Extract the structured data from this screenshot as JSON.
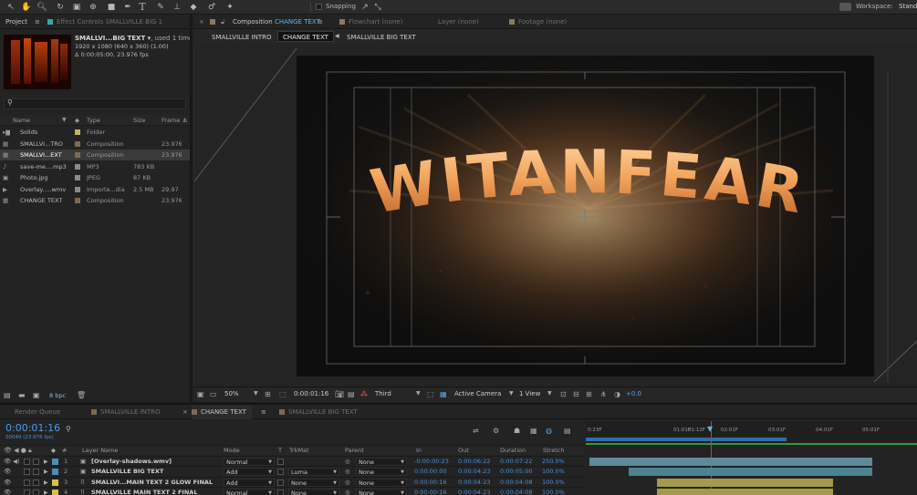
{
  "toolbar": {
    "tools": [
      "arrow-tool-icon",
      "hand-tool-icon",
      "zoom-tool-icon",
      "rotate-tool-icon",
      "camera-tool-icon",
      "pan-behind-icon",
      "rectangle-tool-icon",
      "pen-tool-icon",
      "type-tool-icon",
      "brush-tool-icon",
      "clone-stamp-icon",
      "eraser-tool-icon",
      "roto-brush-icon",
      "puppet-tool-icon"
    ],
    "snapping_label": "Snapping",
    "workspace_label": "Workspace:",
    "workspace_value": "Stand"
  },
  "project_panel": {
    "tab_label": "Project",
    "effect_controls_tab": "Effect Controls SMALLVILLE BIG 1",
    "item_name": "SMALLVI...BIG TEXT ▾",
    "item_used": ", used 1 time",
    "item_res": "1920 x 1080  (640 x 360) (1.00)",
    "item_dur": "Δ 0:00:05:00, 23.976 fps",
    "search_placeholder": "",
    "columns": [
      "Name",
      "Type",
      "Size",
      "Frame ..."
    ],
    "items": [
      {
        "name": "Solids",
        "type": "Folder",
        "size": "",
        "frame": "",
        "color": "#c8b260",
        "icon": "folder-icon"
      },
      {
        "name": "SMALLVI...TRO",
        "type": "Composition",
        "size": "",
        "frame": "23.976",
        "color": "#7f6a50",
        "icon": "composition-icon"
      },
      {
        "name": "SMALLVI...EXT",
        "type": "Composition",
        "size": "",
        "frame": "23.976",
        "color": "#7f6a50",
        "icon": "composition-icon"
      },
      {
        "name": "save-me....mp3",
        "type": "MP3",
        "size": "783 KB",
        "frame": "",
        "color": "#8a8a8a",
        "icon": "audio-file-icon"
      },
      {
        "name": "Photo.jpg",
        "type": "JPEG",
        "size": "87 KB",
        "frame": "",
        "color": "#8a8a8a",
        "icon": "image-file-icon"
      },
      {
        "name": "Overlay.....wmv",
        "type": "Importe...dia",
        "size": "2.5 MB",
        "frame": "29.97",
        "color": "#8a8a8a",
        "icon": "video-file-icon"
      },
      {
        "name": "CHANGE TEXT",
        "type": "Composition",
        "size": "",
        "frame": "23.976",
        "color": "#7f6a50",
        "icon": "composition-icon"
      }
    ],
    "bpc_label": "8 bpc"
  },
  "viewer": {
    "tabs": [
      {
        "label": "Composition",
        "accent": "CHANGE TEXT"
      },
      {
        "label": "Flowchart (none)"
      },
      {
        "label": "Layer (none)"
      },
      {
        "label": "Footage (none)"
      }
    ],
    "breadcrumbs": [
      "SMALLVILLE INTRO",
      "CHANGE TEXT",
      "SMALLVILLE BIG TEXT"
    ],
    "title_text": "WITANFEAR",
    "zoom": "50%",
    "timecode": "0:00:01:16",
    "resolution": "Third",
    "camera": "Active Camera",
    "view_count": "1 View",
    "exposure": "+0.0"
  },
  "timeline": {
    "tabs": [
      "Render Queue",
      "SMALLVILLE INTRO",
      "CHANGE TEXT",
      "SMALLVILLE BIG TEXT"
    ],
    "active_tab": "CHANGE TEXT",
    "timecode": "0:00:01:16",
    "frame_info": "00040 (23.976 fps)",
    "search_placeholder": "",
    "columns": [
      "#",
      "Layer Name",
      "Mode",
      "T",
      "TrkMat",
      "Parent",
      "In",
      "Out",
      "Duration",
      "Stretch"
    ],
    "ruler": [
      "0:23F",
      "01:01F",
      "01:12F",
      "02:01F",
      "03:01F",
      "04:01F",
      "05:01F"
    ],
    "layers": [
      {
        "num": "1",
        "name": "[Overlay-shadows.wmv]",
        "mode": "Normal",
        "trkmat": "",
        "parent": "None",
        "in": "-0:00:00:23",
        "out": "0:00:06:22",
        "duration": "0:00:07:22",
        "stretch": "250.0%",
        "color": "#4a8fb5",
        "bar_color": "#5f8a99",
        "bar_start": 0.0,
        "bar_end": 1.0
      },
      {
        "num": "2",
        "name": "SMALLVILLE BIG TEXT",
        "mode": "Add",
        "trkmat": "Luma",
        "parent": "None",
        "in": "0:00:00:00",
        "out": "0:00:04:23",
        "duration": "0:00:05:00",
        "stretch": "100.0%",
        "color": "#4a8fb5",
        "bar_color": "#4b8390",
        "bar_start": 0.14,
        "bar_end": 1.0
      },
      {
        "num": "3",
        "name": "SMALLVI...MAIN TEXT 2 GLOW FINAL",
        "mode": "Add",
        "trkmat": "None",
        "parent": "None",
        "in": "0:00:00:16",
        "out": "0:00:04:23",
        "duration": "0:00:04:08",
        "stretch": "100.0%",
        "color": "#d4c14c",
        "bar_color": "#a39b4a",
        "bar_start": 0.24,
        "bar_end": 0.86
      },
      {
        "num": "4",
        "name": "SMALLVILLE MAIN TEXT 2 FINAL",
        "mode": "Normal",
        "trkmat": "None",
        "parent": "None",
        "in": "0:00:00:16",
        "out": "0:00:04:23",
        "duration": "0:00:04:08",
        "stretch": "100.0%",
        "color": "#d4c14c",
        "bar_color": "#a39b4a",
        "bar_start": 0.24,
        "bar_end": 0.86
      }
    ]
  }
}
